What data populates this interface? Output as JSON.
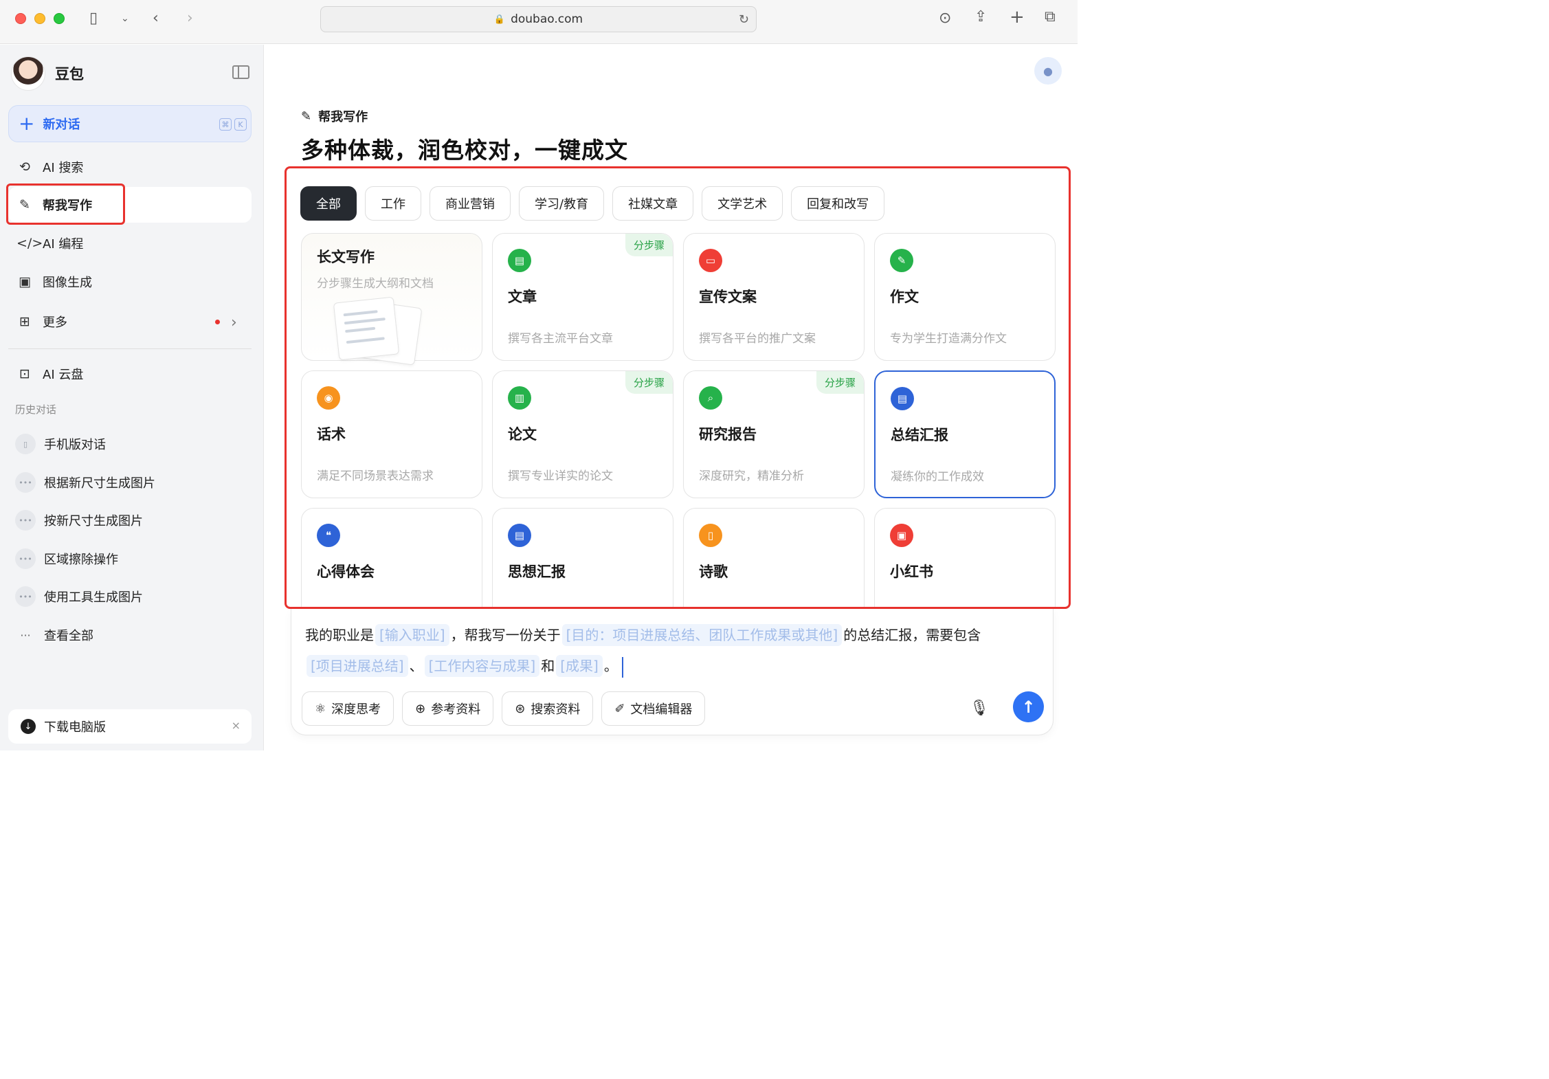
{
  "browser": {
    "url": "doubao.com"
  },
  "sidebar": {
    "app_name": "豆包",
    "new_chat": {
      "label": "新对话",
      "shortcut_keys": [
        "⌘",
        "K"
      ]
    },
    "nav": [
      {
        "label": "AI 搜索",
        "icon": "search-sparkle-icon"
      },
      {
        "label": "帮我写作",
        "icon": "pen-sparkle-icon",
        "active": true
      },
      {
        "label": "AI 编程",
        "icon": "code-icon"
      },
      {
        "label": "图像生成",
        "icon": "image-icon"
      },
      {
        "label": "更多",
        "icon": "grid-icon"
      }
    ],
    "cloud": {
      "label": "AI 云盘",
      "icon": "folder-cloud-icon"
    },
    "history_title": "历史对话",
    "history": [
      {
        "label": "手机版对话",
        "icon": "phone-icon"
      },
      {
        "label": "根据新尺寸生成图片",
        "icon": "chat-bubble-icon"
      },
      {
        "label": "按新尺寸生成图片",
        "icon": "chat-bubble-icon"
      },
      {
        "label": "区域擦除操作",
        "icon": "chat-bubble-icon"
      },
      {
        "label": "使用工具生成图片",
        "icon": "chat-bubble-icon"
      }
    ],
    "view_all": "查看全部",
    "download": {
      "label": "下载电脑版",
      "close": "×"
    }
  },
  "main": {
    "section_label": "帮我写作",
    "headline": "多种体裁，润色校对，一键成文",
    "tabs": [
      "全部",
      "工作",
      "商业营销",
      "学习/教育",
      "社媒文章",
      "文学艺术",
      "回复和改写"
    ],
    "feature_card": {
      "title": "长文写作",
      "desc": "分步骤生成大纲和文档"
    },
    "cards": [
      {
        "title": "文章",
        "desc": "撰写各主流平台文章",
        "badge": "分步骤",
        "icon": "article-icon",
        "color": "#26b24b"
      },
      {
        "title": "宣传文案",
        "desc": "撰写各平台的推广文案",
        "badge": "",
        "icon": "message-icon",
        "color": "#ef3e36"
      },
      {
        "title": "作文",
        "desc": "专为学生打造满分作文",
        "badge": "",
        "icon": "pencil-icon",
        "color": "#26b24b"
      },
      {
        "title": "话术",
        "desc": "满足不同场景表达需求",
        "badge": "",
        "icon": "speaker-icon",
        "color": "#f7931e"
      },
      {
        "title": "论文",
        "desc": "撰写专业详实的论文",
        "badge": "分步骤",
        "icon": "books-icon",
        "color": "#26b24b"
      },
      {
        "title": "研究报告",
        "desc": "深度研究，精准分析",
        "badge": "分步骤",
        "icon": "report-icon",
        "color": "#26b24b"
      },
      {
        "title": "总结汇报",
        "desc": "凝练你的工作成效",
        "badge": "",
        "icon": "summary-icon",
        "color": "#2e63d7",
        "selected": true
      },
      {
        "title": "心得体会",
        "desc": "",
        "badge": "",
        "icon": "notes-icon",
        "color": "#2e63d7"
      },
      {
        "title": "思想汇报",
        "desc": "",
        "badge": "",
        "icon": "doc-chart-icon",
        "color": "#2e63d7"
      },
      {
        "title": "诗歌",
        "desc": "",
        "badge": "",
        "icon": "poem-icon",
        "color": "#f7931e"
      },
      {
        "title": "小红书",
        "desc": "",
        "badge": "",
        "icon": "image-card-icon",
        "color": "#ef3e36"
      }
    ]
  },
  "composer": {
    "prompt": {
      "p1": "我的职业是",
      "slot1": "[输入职业]",
      "p2": "，帮我写一份关于",
      "slot2": "[目的：项目进展总结、团队工作成果或其他]",
      "p3": "的总结汇报，需要包含",
      "slot3": "[项目进展总结]",
      "p4": "、",
      "slot4": "[工作内容与成果]",
      "p5": "和",
      "slot5": "[成果]",
      "p6": "。"
    },
    "tools": [
      {
        "label": "深度思考",
        "icon": "atom-icon"
      },
      {
        "label": "参考资料",
        "icon": "plus-circle-icon"
      },
      {
        "label": "搜索资料",
        "icon": "globe-icon"
      },
      {
        "label": "文档编辑器",
        "icon": "edit-doc-icon"
      }
    ]
  }
}
